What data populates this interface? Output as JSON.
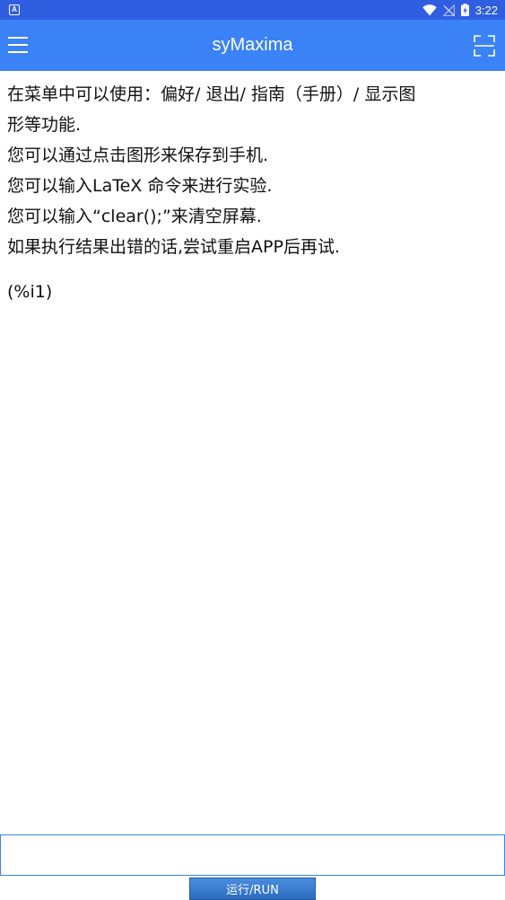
{
  "status_bar": {
    "notification_glyph": "A",
    "time": "3:22",
    "icons": [
      "wifi-icon",
      "no-signal-icon",
      "battery-charging-icon"
    ]
  },
  "app_bar": {
    "title": "syMaxima",
    "left_icon": "hamburger-menu-icon",
    "right_icon": "scan-icon",
    "background_color": "#3b82f6"
  },
  "console": {
    "lines": [
      "在菜单中可以使用：偏好/ 退出/ 指南（手册）/ 显示图",
      "形等功能.",
      "您可以通过点击图形来保存到手机.",
      "您可以输入LaTeX 命令来进行实验.",
      "您可以输入“clear();”来清空屏幕.",
      "如果执行结果出错的话,尝试重启APP后再试."
    ],
    "prompt": "(%i1)"
  },
  "input": {
    "value": "",
    "placeholder": ""
  },
  "run_button": {
    "label": "运行/RUN"
  }
}
